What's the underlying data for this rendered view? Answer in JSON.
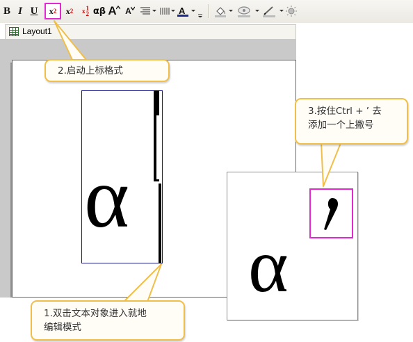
{
  "toolbar": {
    "bold": "B",
    "italic": "I",
    "underline": "U",
    "superscript": {
      "base": "x",
      "mark": "2"
    },
    "subscript": {
      "base": "x",
      "mark": "2"
    },
    "supersubscript": {
      "base": "x",
      "upper": "1",
      "lower": "2"
    },
    "greek": "αβ",
    "font_increase": "A",
    "font_decrease": "A",
    "font_color_label": "A",
    "font_color": "#1a2a8c",
    "icons": [
      "align-icon",
      "spacing-icon",
      "font-color-icon",
      "fill-color-icon",
      "line-style-icon",
      "line-color-icon",
      "sun-icon"
    ]
  },
  "window": {
    "tab_title": "Layout1"
  },
  "canvas": {
    "big_symbol": "α",
    "preview_symbol": "α"
  },
  "callouts": {
    "step1": {
      "line1": "1.双击文本对象进入就地",
      "line2": "编辑模式"
    },
    "step2": {
      "line1": "2.启动上标格式"
    },
    "step3": {
      "line1": "3.按住Ctrl + ’ 去",
      "line2": "添加一个上撇号"
    }
  },
  "colors": {
    "highlight": "#e02ad0",
    "callout_border": "#f0be4a",
    "selection_border": "#1a1a8c"
  }
}
